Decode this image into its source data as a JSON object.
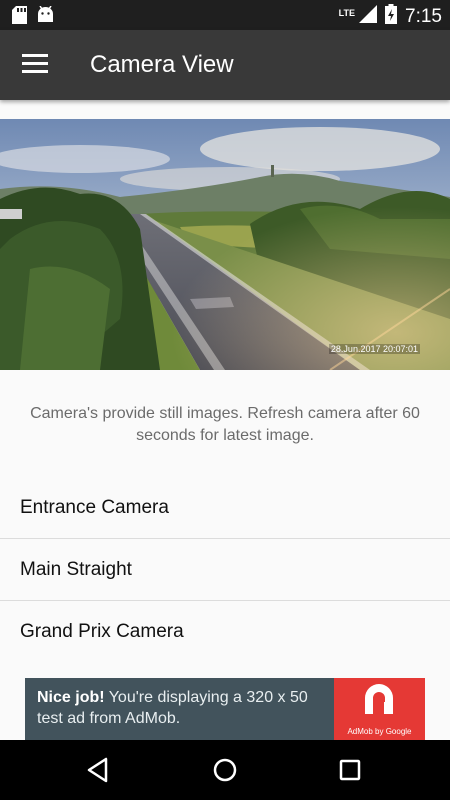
{
  "status_bar": {
    "network_label": "LTE",
    "time": "7:15",
    "icons": [
      "sd-card-icon",
      "android-icon",
      "signal-icon",
      "battery-charging-icon"
    ]
  },
  "app_bar": {
    "title": "Camera View",
    "menu_icon": "hamburger-menu-icon"
  },
  "camera": {
    "timestamp": "28.Jun.2017  20:07:01"
  },
  "info": {
    "line1": "Camera's provide still images. Refresh camera after 60",
    "line2": "seconds for latest image."
  },
  "camera_list": [
    {
      "label": "Entrance Camera"
    },
    {
      "label": "Main Straight"
    },
    {
      "label": "Grand Prix Camera"
    }
  ],
  "ad": {
    "headline": "Nice job!",
    "body": " You're displaying a 320 x 50 test ad from AdMob.",
    "logo_caption": "AdMob by Google",
    "background_color": "#42535c",
    "logo_color": "#e53935"
  },
  "nav_bar": {
    "icons": [
      "back-icon",
      "home-icon",
      "recents-icon"
    ]
  }
}
